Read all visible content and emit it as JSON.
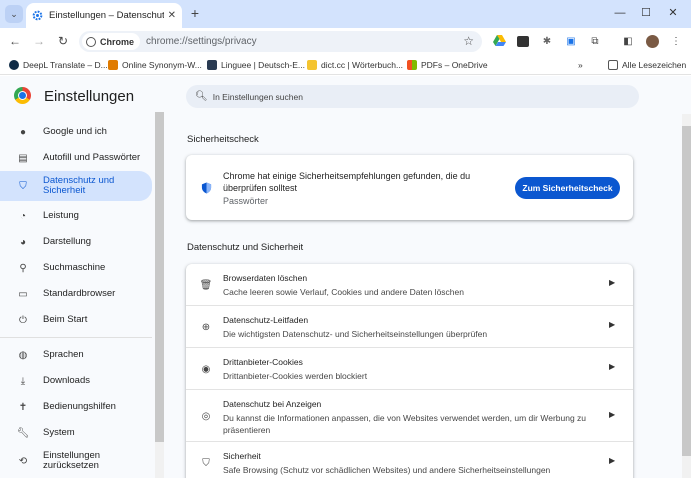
{
  "tab": {
    "title": "Einstellungen – Datenschutz und Sicherheit"
  },
  "toolbar": {
    "chip_label": "Chrome",
    "url": "chrome://settings/privacy"
  },
  "bookmarks": {
    "items": [
      {
        "label": "DeepL Translate – D..."
      },
      {
        "label": "Online Synonym-W..."
      },
      {
        "label": "Linguee | Deutsch-E..."
      },
      {
        "label": "dict.cc | Wörterbuch..."
      },
      {
        "label": "PDFs – OneDrive"
      }
    ],
    "overflow": "»",
    "all_bookmarks": "Alle Lesezeichen"
  },
  "settings": {
    "title": "Einstellungen",
    "search_placeholder": "In Einstellungen suchen",
    "sidebar": {
      "items": [
        {
          "label": "Google und ich",
          "icon": "person-icon"
        },
        {
          "label": "Autofill und Passwörter",
          "icon": "clipboard-icon"
        },
        {
          "label": "Datenschutz und Sicherheit",
          "icon": "shield-icon",
          "active": true
        },
        {
          "label": "Leistung",
          "icon": "gauge-icon"
        },
        {
          "label": "Darstellung",
          "icon": "palette-icon"
        },
        {
          "label": "Suchmaschine",
          "icon": "search-icon"
        },
        {
          "label": "Standardbrowser",
          "icon": "browser-icon"
        },
        {
          "label": "Beim Start",
          "icon": "power-icon"
        },
        {
          "label": "Sprachen",
          "icon": "globe-icon"
        },
        {
          "label": "Downloads",
          "icon": "download-icon"
        },
        {
          "label": "Bedienungshilfen",
          "icon": "accessibility-icon"
        },
        {
          "label": "System",
          "icon": "wrench-icon"
        },
        {
          "label": "Einstellungen zurücksetzen",
          "icon": "reset-icon"
        }
      ]
    },
    "safety_check": {
      "heading": "Sicherheitscheck",
      "text": "Chrome hat einige Sicherheitsempfehlungen gefunden, die du überprüfen solltest",
      "sub": "Passwörter",
      "button": "Zum Sicherheitscheck"
    },
    "privacy": {
      "heading": "Datenschutz und Sicherheit",
      "rows": [
        {
          "title": "Browserdaten löschen",
          "sub": "Cache leeren sowie Verlauf, Cookies und andere Daten löschen",
          "icon": "trash-icon"
        },
        {
          "title": "Datenschutz-Leitfaden",
          "sub": "Die wichtigsten Datenschutz- und Sicherheitseinstellungen überprüfen",
          "icon": "compass-icon"
        },
        {
          "title": "Drittanbieter-Cookies",
          "sub": "Drittanbieter-Cookies werden blockiert",
          "icon": "cookie-icon"
        },
        {
          "title": "Datenschutz bei Anzeigen",
          "sub": "Du kannst die Informationen anpassen, die von Websites verwendet werden, um dir Werbung zu präsentieren",
          "icon": "ads-icon"
        },
        {
          "title": "Sicherheit",
          "sub": "Safe Browsing (Schutz vor schädlichen Websites) und andere Sicherheitseinstellungen",
          "icon": "shield-icon"
        }
      ]
    }
  },
  "colors": {
    "accent": "#0b57d0",
    "tabstrip": "#d3e3fd",
    "page_bg": "#f8fafd"
  }
}
